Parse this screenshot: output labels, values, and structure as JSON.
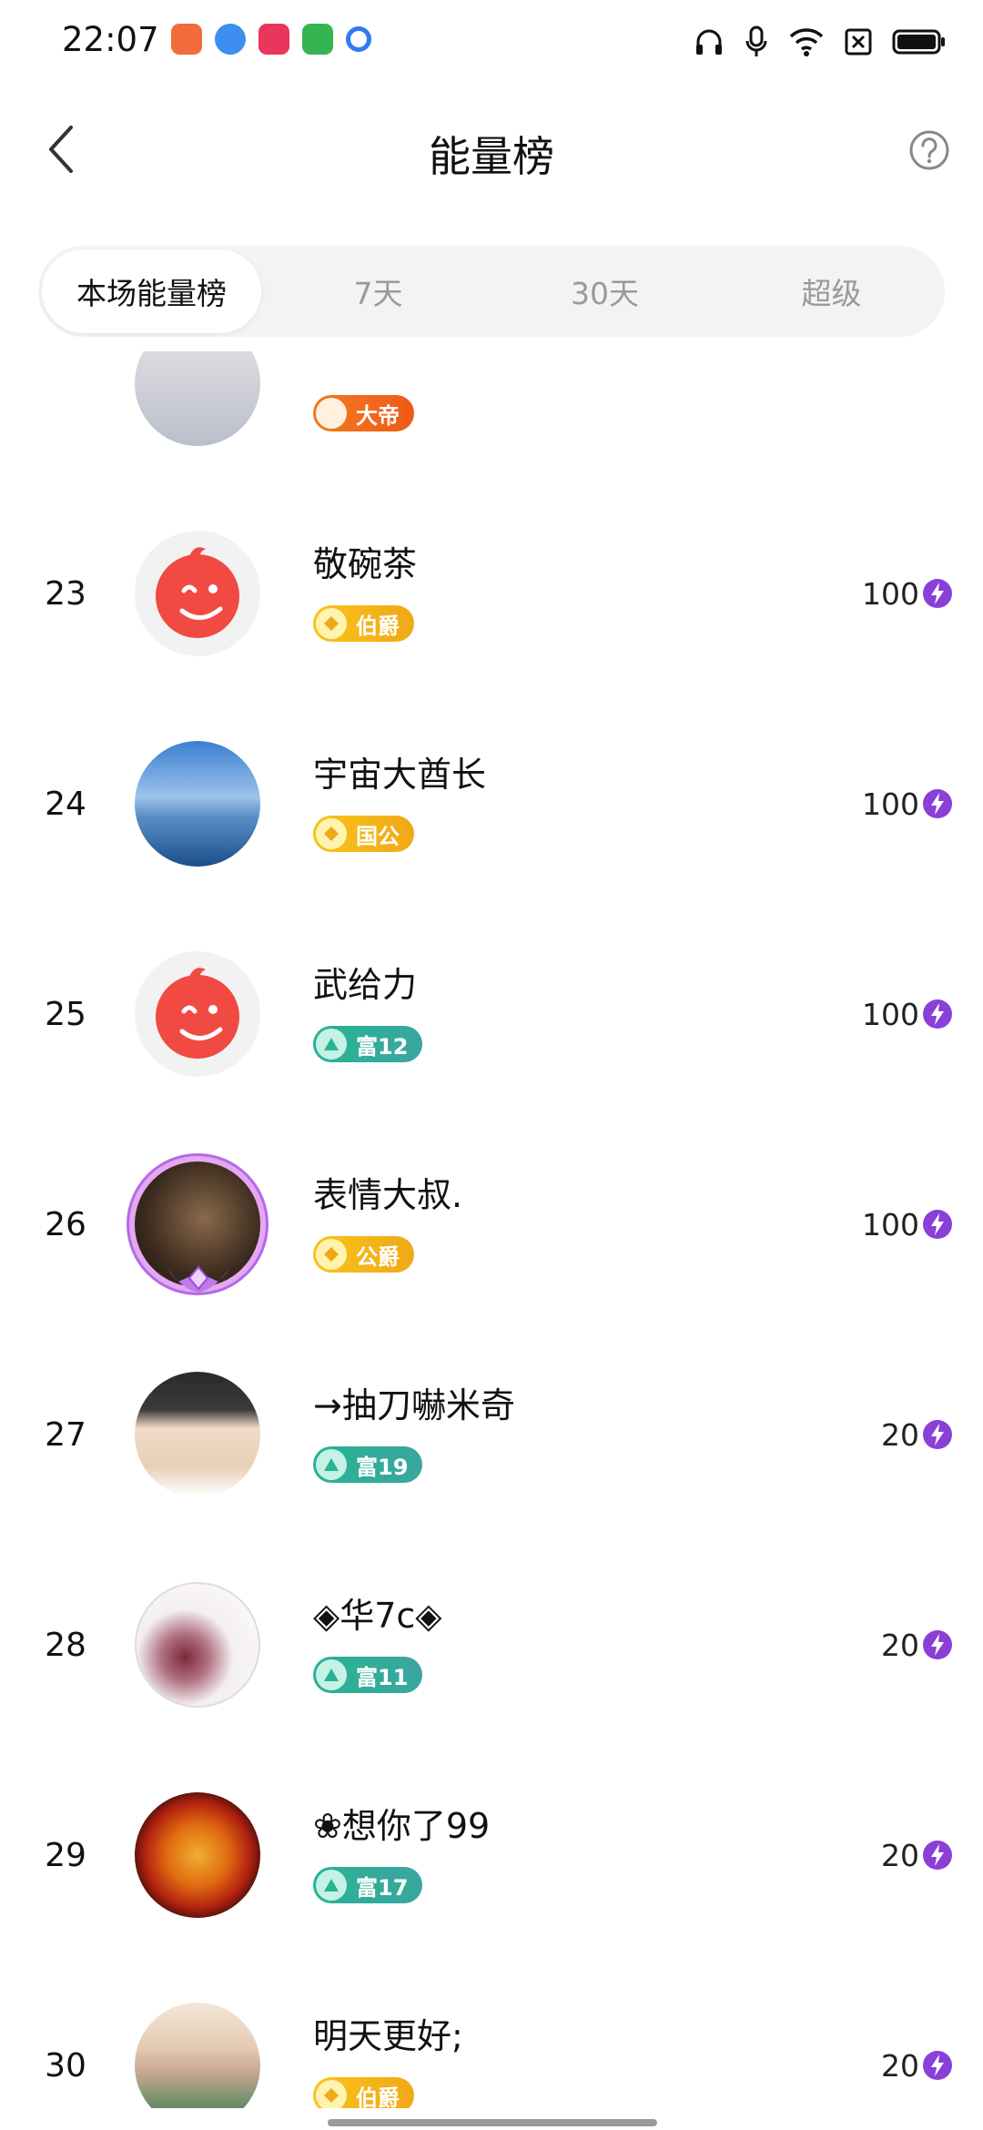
{
  "status_bar": {
    "time": "22:07",
    "app_icons": [
      {
        "name": "video-app-icon",
        "color": "#f26b3a"
      },
      {
        "name": "browser-app-icon",
        "color": "#3d8ef0"
      },
      {
        "name": "play-app-icon",
        "color": "#e8365d"
      },
      {
        "name": "store-app-icon",
        "color": "#35b452"
      },
      {
        "name": "search-app-icon",
        "color": "#2f7bf5"
      }
    ],
    "indicators": [
      "headset-icon",
      "mic-icon",
      "wifi-icon",
      "sim-off-icon",
      "battery-icon"
    ]
  },
  "header": {
    "title": "能量榜",
    "back_icon": "chevron-left-icon",
    "help_icon": "question-circle-icon"
  },
  "tabs": [
    {
      "label": "本场能量榜",
      "active": true
    },
    {
      "label": "7天",
      "active": false
    },
    {
      "label": "30天",
      "active": false
    },
    {
      "label": "超级",
      "active": false
    }
  ],
  "rows": [
    {
      "rank": "",
      "name": "",
      "badge": {
        "type": "emperor",
        "label": "大帝"
      },
      "score": "",
      "avatar": "partial-avatar"
    },
    {
      "rank": "23",
      "name": "敬碗茶",
      "badge": {
        "type": "noble",
        "label": "伯爵"
      },
      "score": "100",
      "avatar": "default-red"
    },
    {
      "rank": "24",
      "name": "宇宙大酋长",
      "badge": {
        "type": "noble",
        "label": "国公"
      },
      "score": "100",
      "avatar": "sky-photo"
    },
    {
      "rank": "25",
      "name": "武给力",
      "badge": {
        "type": "rich",
        "label": "富12"
      },
      "score": "100",
      "avatar": "default-red"
    },
    {
      "rank": "26",
      "name": "表情大叔.",
      "badge": {
        "type": "noble",
        "label": "公爵"
      },
      "score": "100",
      "avatar": "framed-photo"
    },
    {
      "rank": "27",
      "name": "→抽刀嚇米奇",
      "badge": {
        "type": "rich",
        "label": "富19"
      },
      "score": "20",
      "avatar": "anime-photo"
    },
    {
      "rank": "28",
      "name": "◈华7c◈",
      "badge": {
        "type": "rich",
        "label": "富11"
      },
      "score": "20",
      "avatar": "pipa-photo"
    },
    {
      "rank": "29",
      "name": "❀想你了99",
      "badge": {
        "type": "rich",
        "label": "富17"
      },
      "score": "20",
      "avatar": "dragon-photo"
    },
    {
      "rank": "30",
      "name": "明天更好;",
      "badge": {
        "type": "noble",
        "label": "伯爵"
      },
      "score": "20",
      "avatar": "girl-photo"
    }
  ],
  "colors": {
    "noble_badge": "#f4b51a",
    "rich_badge": "#2fae98",
    "emperor_badge": "#f26a1b",
    "energy_icon": "#8a3fd6",
    "default_avatar": "#f04a43"
  }
}
